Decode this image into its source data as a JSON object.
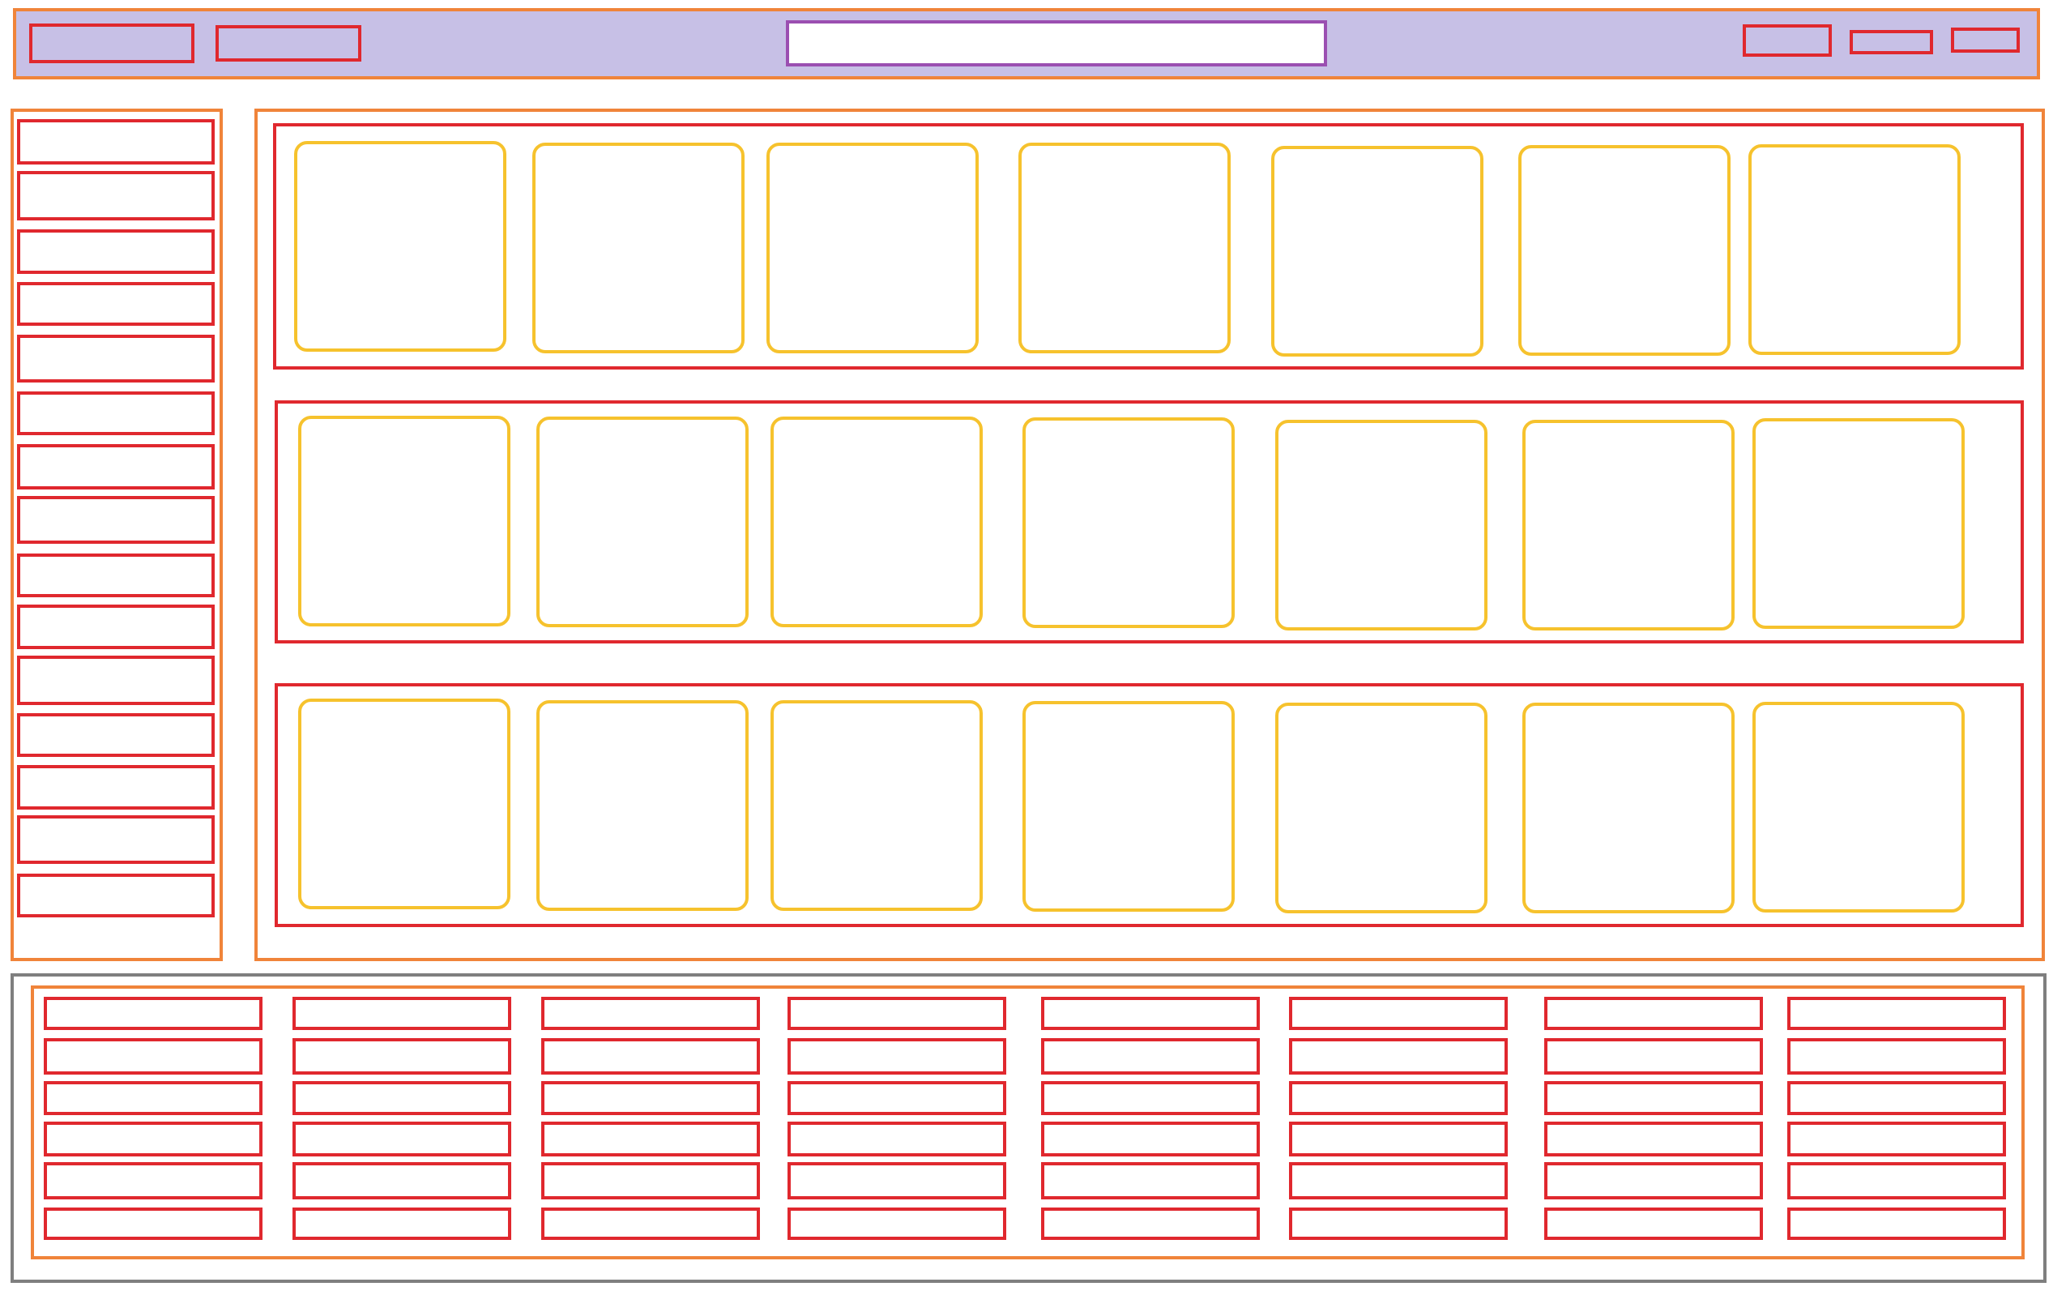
{
  "colors": {
    "header_background": "#c7c0e6",
    "container_border": "#f0843a",
    "element_border": "#e0282e",
    "search_border": "#9b4fb1",
    "card_border": "#f6c22d",
    "footer_border": "#7f7f7f"
  },
  "header": {
    "left_buttons": [
      {
        "label": ""
      },
      {
        "label": ""
      }
    ],
    "search": {
      "value": "",
      "placeholder": ""
    },
    "right_buttons": [
      {
        "label": ""
      },
      {
        "label": ""
      },
      {
        "label": ""
      }
    ]
  },
  "sidebar": {
    "items": [
      {
        "label": ""
      },
      {
        "label": ""
      },
      {
        "label": ""
      },
      {
        "label": ""
      },
      {
        "label": ""
      },
      {
        "label": ""
      },
      {
        "label": ""
      },
      {
        "label": ""
      },
      {
        "label": ""
      },
      {
        "label": ""
      },
      {
        "label": ""
      },
      {
        "label": ""
      },
      {
        "label": ""
      },
      {
        "label": ""
      },
      {
        "label": ""
      }
    ]
  },
  "main": {
    "rows": [
      {
        "cards": [
          {
            "label": ""
          },
          {
            "label": ""
          },
          {
            "label": ""
          },
          {
            "label": ""
          },
          {
            "label": ""
          },
          {
            "label": ""
          },
          {
            "label": ""
          }
        ]
      },
      {
        "cards": [
          {
            "label": ""
          },
          {
            "label": ""
          },
          {
            "label": ""
          },
          {
            "label": ""
          },
          {
            "label": ""
          },
          {
            "label": ""
          },
          {
            "label": ""
          }
        ]
      },
      {
        "cards": [
          {
            "label": ""
          },
          {
            "label": ""
          },
          {
            "label": ""
          },
          {
            "label": ""
          },
          {
            "label": ""
          },
          {
            "label": ""
          },
          {
            "label": ""
          }
        ]
      }
    ]
  },
  "footer": {
    "columns": [
      {
        "links": [
          {
            "label": ""
          },
          {
            "label": ""
          },
          {
            "label": ""
          },
          {
            "label": ""
          },
          {
            "label": ""
          },
          {
            "label": ""
          }
        ]
      },
      {
        "links": [
          {
            "label": ""
          },
          {
            "label": ""
          },
          {
            "label": ""
          },
          {
            "label": ""
          },
          {
            "label": ""
          },
          {
            "label": ""
          }
        ]
      },
      {
        "links": [
          {
            "label": ""
          },
          {
            "label": ""
          },
          {
            "label": ""
          },
          {
            "label": ""
          },
          {
            "label": ""
          },
          {
            "label": ""
          }
        ]
      },
      {
        "links": [
          {
            "label": ""
          },
          {
            "label": ""
          },
          {
            "label": ""
          },
          {
            "label": ""
          },
          {
            "label": ""
          },
          {
            "label": ""
          }
        ]
      },
      {
        "links": [
          {
            "label": ""
          },
          {
            "label": ""
          },
          {
            "label": ""
          },
          {
            "label": ""
          },
          {
            "label": ""
          },
          {
            "label": ""
          }
        ]
      },
      {
        "links": [
          {
            "label": ""
          },
          {
            "label": ""
          },
          {
            "label": ""
          },
          {
            "label": ""
          },
          {
            "label": ""
          },
          {
            "label": ""
          }
        ]
      },
      {
        "links": [
          {
            "label": ""
          },
          {
            "label": ""
          },
          {
            "label": ""
          },
          {
            "label": ""
          },
          {
            "label": ""
          },
          {
            "label": ""
          }
        ]
      },
      {
        "links": [
          {
            "label": ""
          },
          {
            "label": ""
          },
          {
            "label": ""
          },
          {
            "label": ""
          },
          {
            "label": ""
          },
          {
            "label": ""
          }
        ]
      }
    ]
  }
}
